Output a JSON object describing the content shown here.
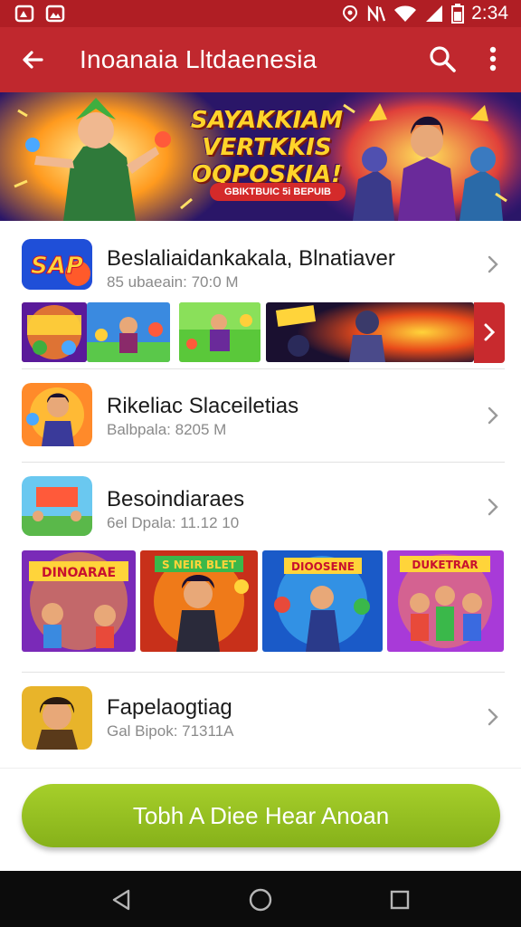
{
  "status_bar": {
    "time": "2:34"
  },
  "app_bar": {
    "title": "Inoanaia Lltdaenesia"
  },
  "banner": {
    "title_lines": [
      "SAYAKKIAM",
      "VERTKKIS",
      "OQPOSKIA!"
    ],
    "subtitle": "GBIKTBUIC 5i BEPUIB"
  },
  "apps": [
    {
      "name": "Beslaliaidankakala, Blnatiaver",
      "meta": "85 ubaeain: 70:0 M"
    },
    {
      "name": "Rikeliac Slaceiletias",
      "meta": "Balbpala: 8205 M"
    },
    {
      "name": "Besoindiaraes",
      "meta": "6el Dpala: 11.12 10"
    },
    {
      "name": "Fapelaogtiag",
      "meta": "Gal Bipok: 71311A"
    }
  ],
  "icons": {
    "app1": "SAP",
    "screenshot_labels": [
      "DINOARAE",
      "DIOOSENE",
      "DUKETRAR",
      "S NEIR BLET"
    ]
  },
  "cta": {
    "label": "Tobh A Diee Hear Anoan"
  },
  "colors": {
    "accent": "#c0282e",
    "cta": "#96c020"
  }
}
